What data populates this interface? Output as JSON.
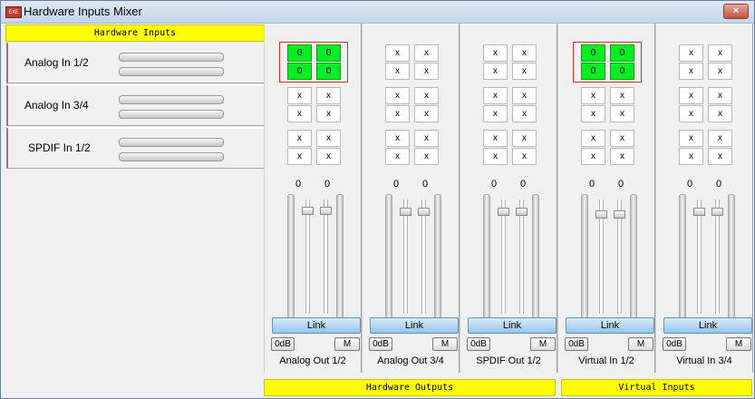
{
  "window": {
    "title": "Hardware Inputs Mixer",
    "app_icon": "exe-app-icon",
    "close": "×"
  },
  "left": {
    "header": "Hardware Inputs",
    "inputs": [
      {
        "label": "Analog In  1/2"
      },
      {
        "label": "Analog In  3/4"
      },
      {
        "label": "SPDIF In 1/2"
      }
    ]
  },
  "strips": [
    {
      "label": "Analog Out 1/2",
      "gain_l": "0",
      "gain_r": "0",
      "link": "Link",
      "odb": "0dB",
      "mute": "M",
      "matrix": [
        [
          "0",
          "0"
        ],
        [
          "0",
          "0"
        ],
        [
          "x",
          "x"
        ],
        [
          "x",
          "x"
        ],
        [
          "x",
          "x"
        ],
        [
          "x",
          "x"
        ]
      ]
    },
    {
      "label": "Analog Out 3/4",
      "gain_l": "0",
      "gain_r": "0",
      "link": "Link",
      "odb": "0dB",
      "mute": "M",
      "matrix": [
        [
          "x",
          "x"
        ],
        [
          "x",
          "x"
        ],
        [
          "x",
          "x"
        ],
        [
          "x",
          "x"
        ],
        [
          "x",
          "x"
        ],
        [
          "x",
          "x"
        ]
      ]
    },
    {
      "label": "SPDIF Out 1/2",
      "gain_l": "0",
      "gain_r": "0",
      "link": "Link",
      "odb": "0dB",
      "mute": "M",
      "matrix": [
        [
          "x",
          "x"
        ],
        [
          "x",
          "x"
        ],
        [
          "x",
          "x"
        ],
        [
          "x",
          "x"
        ],
        [
          "x",
          "x"
        ],
        [
          "x",
          "x"
        ]
      ]
    },
    {
      "label": "Virtual In 1/2",
      "gain_l": "0",
      "gain_r": "0",
      "link": "Link",
      "odb": "0dB",
      "mute": "M",
      "matrix": [
        [
          "0",
          "0"
        ],
        [
          "0",
          "0"
        ],
        [
          "x",
          "x"
        ],
        [
          "x",
          "x"
        ],
        [
          "x",
          "x"
        ],
        [
          "x",
          "x"
        ]
      ]
    },
    {
      "label": "Virtual In 3/4",
      "gain_l": "0",
      "gain_r": "0",
      "link": "Link",
      "odb": "0dB",
      "mute": "M",
      "matrix": [
        [
          "x",
          "x"
        ],
        [
          "x",
          "x"
        ],
        [
          "x",
          "x"
        ],
        [
          "x",
          "x"
        ],
        [
          "x",
          "x"
        ],
        [
          "x",
          "x"
        ]
      ]
    }
  ],
  "footer": {
    "outputs": "Hardware Outputs",
    "virtual": "Virtual Inputs"
  }
}
